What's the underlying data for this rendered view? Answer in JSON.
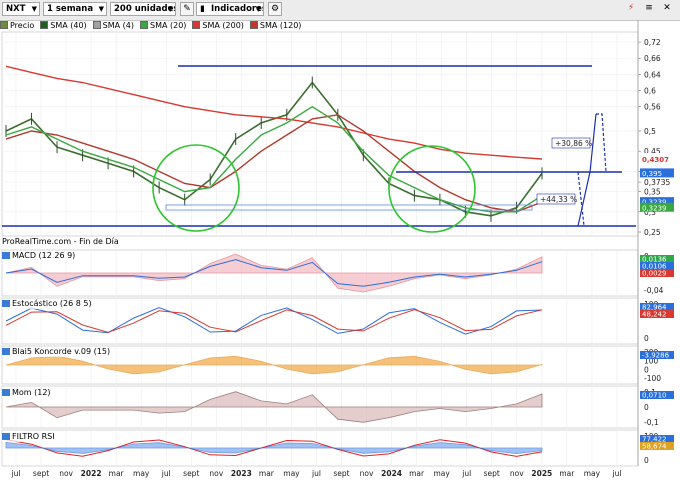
{
  "toolbar": {
    "ticker": "NXT",
    "timeframe": "1 semana",
    "units": "200 unidades",
    "indicators": "Indicadores",
    "icons": [
      "chevron-down-icon",
      "chevron-down-icon",
      "chevron-down-icon",
      "pencil-icon",
      "settings-icon",
      "bars-icon",
      "close-icon"
    ]
  },
  "legend": [
    {
      "name": "Precio",
      "color": "#6a8f3a"
    },
    {
      "name": "SMA (40)",
      "color": "#1f5e1f"
    },
    {
      "name": "SMA (4)",
      "color": "#a0a0a0"
    },
    {
      "name": "SMA (20)",
      "color": "#3aa840"
    },
    {
      "name": "SMA (200)",
      "color": "#d8382f"
    },
    {
      "name": "SMA (120)",
      "color": "#c0392b"
    }
  ],
  "source_label": "ProRealTime.com - Fin de Día",
  "price_axis": {
    "ticks": [
      "0,72",
      "0,66",
      "0,64",
      "0,6",
      "0,56",
      "0,5",
      "0,45",
      "0,4",
      "0,3735",
      "0,35",
      "0,3",
      "0,25"
    ],
    "values": [
      0.72,
      0.68,
      0.64,
      0.6,
      0.56,
      0.5,
      0.45,
      0.4,
      0.3735,
      0.35,
      0.3,
      0.25
    ],
    "last_price": "0,4307",
    "tags": [
      {
        "text": "0,395",
        "value": 0.395,
        "color": "#2a6fdb"
      },
      {
        "text": "0,3239",
        "value": 0.3239,
        "color": "#2a6fdb"
      },
      {
        "text": "0,3239",
        "value": 0.31,
        "color": "#3aa840"
      }
    ]
  },
  "annotations": {
    "pct_up": "+30,86 %",
    "pct_mid": "+44,33 %"
  },
  "x_axis": {
    "labels": [
      "jul",
      "sept",
      "nov",
      "2022",
      "mar",
      "may",
      "jul",
      "sept",
      "nov",
      "2023",
      "mar",
      "may",
      "jul",
      "sept",
      "nov",
      "2024",
      "mar",
      "may",
      "jul",
      "sept",
      "nov",
      "2025",
      "mar",
      "may",
      "jul"
    ],
    "bold": [
      "2022",
      "2023",
      "2024",
      "2025"
    ]
  },
  "panels": {
    "macd": {
      "label": "MACD (12 26 9)",
      "tags": [
        "0,0136",
        "0,0106",
        "0,0029"
      ],
      "ticks": [
        "0",
        "-0,04"
      ]
    },
    "stoch": {
      "label": "Estocástico (26 8 5)",
      "tags": [
        "82,964",
        "48,242"
      ],
      "ticks": [
        "100",
        "0"
      ]
    },
    "koncorde": {
      "label": "Blai5 Koncorde v.09 (15)",
      "tags": [
        "-3,9286"
      ],
      "ticks": [
        "200",
        "100",
        "0",
        "-100"
      ]
    },
    "mom": {
      "label": "Mom (12)",
      "tags": [
        "0,0710"
      ],
      "ticks": [
        "0,1",
        "0",
        "-0,1"
      ]
    },
    "rsi": {
      "label": "FILTRO RSI",
      "tags": [
        "77,422",
        "58,674"
      ],
      "ticks": [
        "100",
        "0"
      ]
    }
  },
  "chart_data": {
    "type": "line",
    "title": "",
    "xlabel": "",
    "ylabel": "",
    "x": [
      "2021-07",
      "2021-09",
      "2021-11",
      "2022-01",
      "2022-03",
      "2022-05",
      "2022-07",
      "2022-09",
      "2022-11",
      "2023-01",
      "2023-03",
      "2023-05",
      "2023-07",
      "2023-09",
      "2023-11",
      "2024-01",
      "2024-03",
      "2024-05",
      "2024-07",
      "2024-09",
      "2024-11",
      "2025-01"
    ],
    "ylim": [
      0.25,
      0.74
    ],
    "series": [
      {
        "name": "Precio",
        "values": [
          0.5,
          0.53,
          0.46,
          0.44,
          0.42,
          0.4,
          0.36,
          0.33,
          0.38,
          0.48,
          0.52,
          0.54,
          0.62,
          0.54,
          0.44,
          0.37,
          0.34,
          0.33,
          0.3,
          0.29,
          0.31,
          0.395
        ]
      },
      {
        "name": "SMA (200)",
        "values": [
          0.66,
          0.645,
          0.63,
          0.62,
          0.605,
          0.59,
          0.575,
          0.56,
          0.55,
          0.54,
          0.535,
          0.53,
          0.52,
          0.51,
          0.495,
          0.48,
          0.47,
          0.455,
          0.445,
          0.44,
          0.435,
          0.4307
        ]
      },
      {
        "name": "SMA (40)",
        "values": [
          0.48,
          0.5,
          0.49,
          0.47,
          0.45,
          0.43,
          0.4,
          0.37,
          0.36,
          0.4,
          0.45,
          0.49,
          0.53,
          0.54,
          0.5,
          0.45,
          0.4,
          0.36,
          0.33,
          0.31,
          0.3,
          0.3239
        ]
      },
      {
        "name": "SMA (20)",
        "values": [
          0.49,
          0.51,
          0.48,
          0.45,
          0.43,
          0.41,
          0.38,
          0.35,
          0.36,
          0.43,
          0.49,
          0.52,
          0.56,
          0.52,
          0.45,
          0.39,
          0.36,
          0.33,
          0.31,
          0.3,
          0.3,
          0.34
        ]
      }
    ]
  }
}
